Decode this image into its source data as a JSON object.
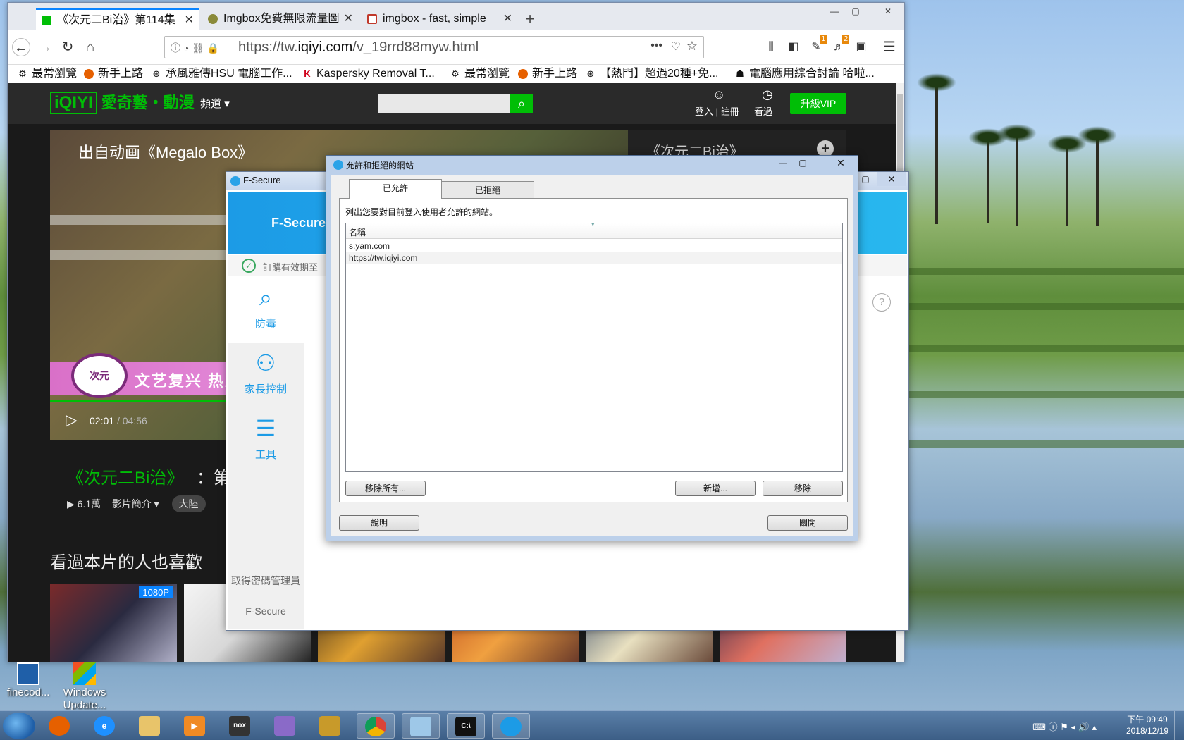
{
  "browser": {
    "tabs": [
      {
        "label": "《次元二Bi治》第114集",
        "active": true
      },
      {
        "label": "Imgbox免費無限流量圖",
        "active": false
      },
      {
        "label": "imgbox - fast, simple",
        "active": false
      }
    ],
    "new_tab": "+",
    "url_host_prefix": "https://tw.",
    "url_host": "iqiyi.com",
    "url_path": "/v_19rrd88myw.html",
    "bookmarks": [
      {
        "label": "最常瀏覽",
        "icon": "gear-icon"
      },
      {
        "label": "新手上路",
        "icon": "firefox-icon"
      },
      {
        "label": "承風雅傳HSU 電腦工作...",
        "icon": "globe-icon"
      },
      {
        "label": "Kaspersky Removal T...",
        "icon": "kaspersky-icon"
      },
      {
        "label": "最常瀏覽",
        "icon": "gear-icon"
      },
      {
        "label": "新手上路",
        "icon": "firefox-icon"
      },
      {
        "label": "【熱門】超過20種+免...",
        "icon": "globe-icon"
      },
      {
        "label": "電腦應用綜合討論 哈啦...",
        "icon": "forum-icon"
      }
    ],
    "badges": [
      "1",
      "2"
    ]
  },
  "iqiyi": {
    "logo": "iQIYI",
    "logo_text": "愛奇藝・動漫",
    "channel_menu": "頻道",
    "login": "登入",
    "register": "註冊",
    "history": "看過",
    "vip_button": "升級VIP",
    "player_title": "出自动画《Megalo Box》",
    "banner_text": "文艺复兴 热血",
    "time_current": "02:01",
    "time_total": "04:56",
    "time_progress_fraction": 0.41,
    "side_title": "《次元二Bi治》",
    "episode_title": "《次元二Bi治》",
    "episode_title_rest": "：第",
    "views": "6.1萬",
    "intro": "影片簡介",
    "tag": "大陸",
    "rec_title": "看過本片的人也喜歡",
    "hd_badge": "1080P"
  },
  "fsecure": {
    "window_title": "F-Secure",
    "brand": "F-Secure",
    "subscription": "訂購有效期至",
    "nav": [
      {
        "label": "防毒",
        "icon": "virus-scan-icon"
      },
      {
        "label": "家長控制",
        "icon": "family-icon"
      },
      {
        "label": "工具",
        "icon": "sliders-icon"
      }
    ],
    "password_manager": "取得密碼管理員",
    "password_brand": "F-Secure",
    "help": "?"
  },
  "dialog": {
    "title": "允許和拒絕的網站",
    "tab_allowed": "已允許",
    "tab_denied": "已拒絕",
    "description": "列出您要對目前登入使用者允許的網站。",
    "column_name": "名稱",
    "sites": [
      "s.yam.com",
      "https://tw.iqiyi.com"
    ],
    "btn_remove_all": "移除所有...",
    "btn_add": "新增...",
    "btn_remove": "移除",
    "btn_help": "說明",
    "btn_close": "關閉"
  },
  "desktop": {
    "icons": [
      {
        "label": "finecod...",
        "icon": "shortcut-icon"
      },
      {
        "label": "Windows Update...",
        "icon": "windows-update-icon"
      }
    ]
  },
  "taskbar": {
    "items": [
      "firefox",
      "ie",
      "explorer",
      "media",
      "nox",
      "app",
      "game",
      "chrome",
      "notes",
      "cmd",
      "fsecure"
    ],
    "time": "下午 09:49",
    "date": "2018/12/19"
  },
  "colors": {
    "iqiyi_green": "#00be06",
    "fsecure_blue": "#1c9be6",
    "firefox_accent": "#0a84ff"
  }
}
